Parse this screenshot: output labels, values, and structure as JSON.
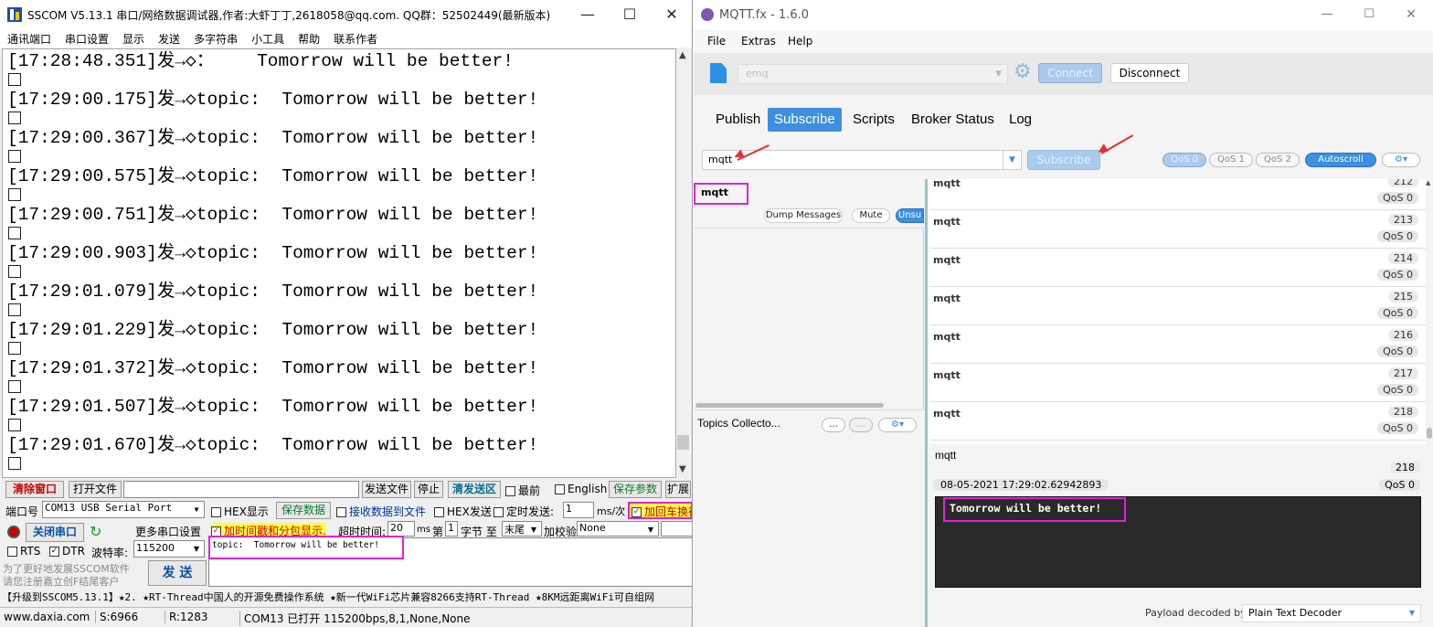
{
  "sscom": {
    "title": "SSCOM V5.13.1 串口/网络数据调试器,作者:大虾丁丁,2618058@qq.com. QQ群：52502449(最新版本)",
    "menu": [
      "通讯端口",
      "串口设置",
      "显示",
      "发送",
      "多字符串",
      "小工具",
      "帮助",
      "联系作者"
    ],
    "terminal_lines": [
      "[17:28:48.351]发→◇：    Tomorrow will be better!",
      "[17:29:00.175]发→◇topic:  Tomorrow will be better!",
      "[17:29:00.367]发→◇topic:  Tomorrow will be better!",
      "[17:29:00.575]发→◇topic:  Tomorrow will be better!",
      "[17:29:00.751]发→◇topic:  Tomorrow will be better!",
      "[17:29:00.903]发→◇topic:  Tomorrow will be better!",
      "[17:29:01.079]发→◇topic:  Tomorrow will be better!",
      "[17:29:01.229]发→◇topic:  Tomorrow will be better!",
      "[17:29:01.372]发→◇topic:  Tomorrow will be better!",
      "[17:29:01.507]发→◇topic:  Tomorrow will be better!",
      "[17:29:01.670]发→◇topic:  Tomorrow will be better!"
    ],
    "clear_window": "清除窗口",
    "open_file": "打开文件",
    "send_file": "发送文件",
    "stop": "停止",
    "clear_send": "清发送区",
    "topmost": "最前",
    "english": "English",
    "save_params": "保存参数",
    "expand": "扩展",
    "port_label": "端口号",
    "port_value": "COM13 USB Serial Port",
    "hex_display": "HEX显示",
    "save_data": "保存数据",
    "recv_to_file": "接收数据到文件",
    "hex_send": "HEX发送",
    "timed_send": "定时发送:",
    "interval_value": "1",
    "interval_unit": "ms/次",
    "add_crlf": "加回车换行",
    "close_port": "关闭串口",
    "more_settings": "更多串口设置",
    "timestamp_split": "加时间戳和分包显示.",
    "timeout_label": "超时时间:",
    "timeout_value": "20",
    "timeout_unit": "ms",
    "byte_prefix": "第",
    "byte_index": "1",
    "byte_label": "字节 至",
    "byte_end": "末尾",
    "checksum_label": "加校验",
    "checksum_value": "None",
    "rts": "RTS",
    "dtr": "DTR",
    "baud_label": "波特率:",
    "baud_value": "115200",
    "send_text": "topic:  Tomorrow will be better!",
    "promo_line1": "为了更好地发展SSCOM软件",
    "promo_line2": "请您注册嘉立创F结尾客户",
    "send_button": "发 送",
    "ticker": "【升级到SSCOM5.13.1】★2. ★RT-Thread中国人的开源免费操作系统 ★新一代WiFi芯片兼容8266支持RT-Thread ★8KM远距离WiFi可自组网",
    "status_site": "www.daxia.com",
    "status_s": "S:6966",
    "status_r": "R:1283",
    "status_port": "COM13 已打开  115200bps,8,1,None,None"
  },
  "mqtt": {
    "title": "MQTT.fx - 1.6.0",
    "menu": [
      "File",
      "Extras",
      "Help"
    ],
    "profile": "emq",
    "connect": "Connect",
    "disconnect": "Disconnect",
    "tabs": [
      "Publish",
      "Subscribe",
      "Scripts",
      "Broker Status",
      "Log"
    ],
    "active_tab": "Subscribe",
    "subscribe_topic": "mqtt",
    "subscribe_button": "Subscribe",
    "qos": [
      "QoS 0",
      "QoS 1",
      "QoS 2"
    ],
    "autoscroll": "Autoscroll",
    "subscription_topic": "mqtt",
    "dump_messages": "Dump Messages",
    "mute": "Mute",
    "unsubscribe": "Unsu",
    "topics_collector": "Topics Collecto...",
    "ellipsis": "...",
    "messages": [
      {
        "topic": "mqtt",
        "num": "212",
        "qos": "QoS 0"
      },
      {
        "topic": "mqtt",
        "num": "213",
        "qos": "QoS 0"
      },
      {
        "topic": "mqtt",
        "num": "214",
        "qos": "QoS 0"
      },
      {
        "topic": "mqtt",
        "num": "215",
        "qos": "QoS 0"
      },
      {
        "topic": "mqtt",
        "num": "216",
        "qos": "QoS 0"
      },
      {
        "topic": "mqtt",
        "num": "217",
        "qos": "QoS 0"
      },
      {
        "topic": "mqtt",
        "num": "218",
        "qos": "QoS 0"
      }
    ],
    "detail": {
      "topic": "mqtt",
      "num": "218",
      "timestamp": "08-05-2021  17:29:02.62942893",
      "qos": "QoS 0",
      "payload": "Tomorrow will be better!",
      "decoder_label": "Payload decoded by",
      "decoder_value": "Plain Text Decoder"
    },
    "colors": {
      "accent": "#3d8fe0",
      "highlight": "#e020e0",
      "arrow": "#e53030"
    }
  }
}
